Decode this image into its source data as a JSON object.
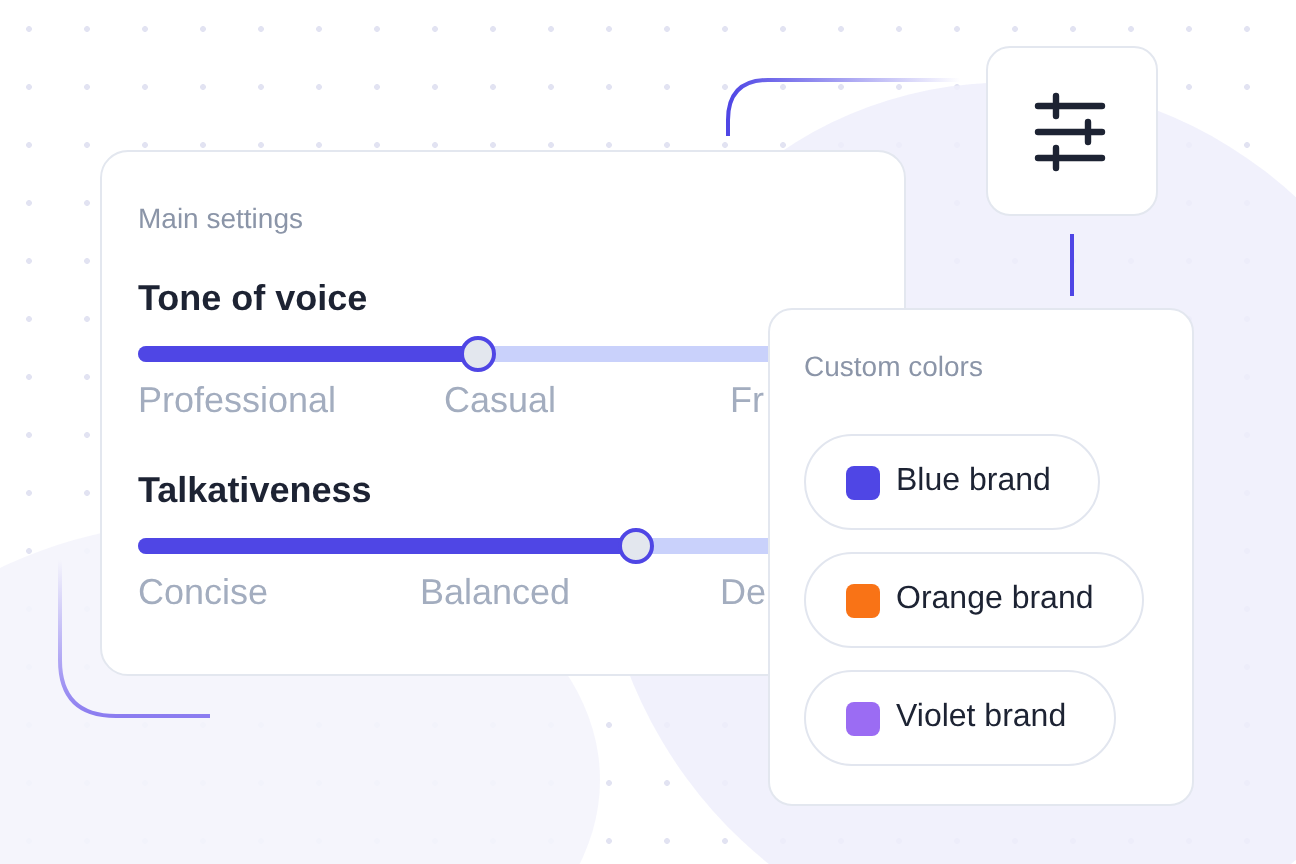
{
  "main_settings": {
    "title": "Main settings",
    "sliders": [
      {
        "label": "Tone of voice",
        "level": 0.54,
        "stops": [
          "Professional",
          "Casual",
          "Fr"
        ]
      },
      {
        "label": "Talkativeness",
        "level": 0.79,
        "stops": [
          "Concise",
          "Balanced",
          "De"
        ]
      }
    ]
  },
  "custom_colors": {
    "title": "Custom colors",
    "items": [
      {
        "label": "Blue brand",
        "color": "#4f46e5"
      },
      {
        "label": "Orange brand",
        "color": "#f97316"
      },
      {
        "label": "Violet brand",
        "color": "#9b6cf3"
      }
    ]
  }
}
